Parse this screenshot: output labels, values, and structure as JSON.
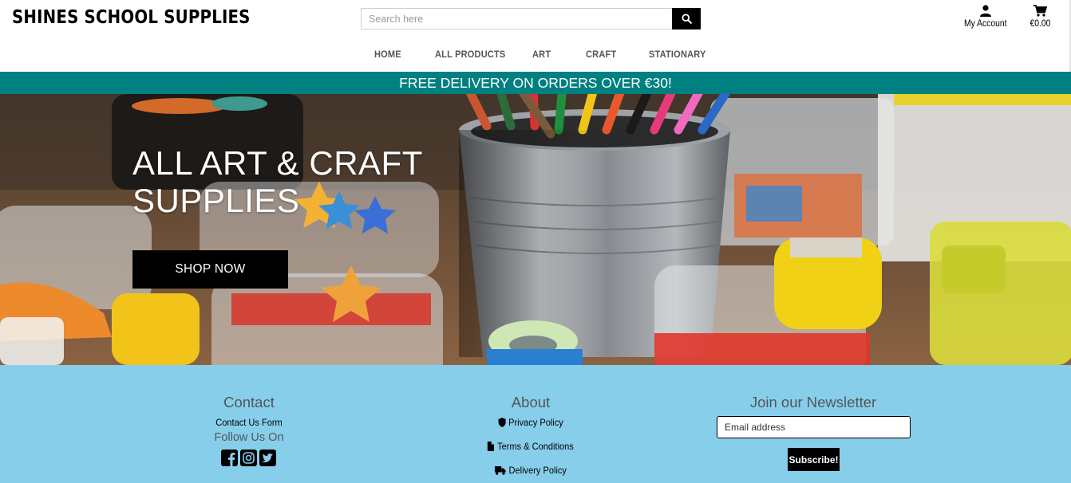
{
  "header": {
    "brand": "SHINES SCHOOL SUPPLIES",
    "search_placeholder": "Search here",
    "account_label": "My Account",
    "cart_total": "€0.00"
  },
  "nav": {
    "items": [
      {
        "label": "HOME"
      },
      {
        "label": "ALL PRODUCTS"
      },
      {
        "label": "ART"
      },
      {
        "label": "CRAFT"
      },
      {
        "label": "STATIONARY"
      }
    ]
  },
  "banner": {
    "text": "FREE DELIVERY ON ORDERS OVER €30!",
    "color": "#008080"
  },
  "hero": {
    "title": "ALL ART & CRAFT SUPPLIES",
    "button_label": "SHOP NOW"
  },
  "footer": {
    "background": "#87ceeb",
    "contact": {
      "title": "Contact",
      "form_link": "Contact Us Form",
      "follow_label": "Follow Us On",
      "social_icons": [
        "facebook-icon",
        "instagram-icon",
        "twitter-icon"
      ]
    },
    "about": {
      "title": "About",
      "links": [
        {
          "label": "Privacy Policy",
          "icon": "shield-icon"
        },
        {
          "label": "Terms & Conditions",
          "icon": "file-icon"
        },
        {
          "label": "Delivery Policy",
          "icon": "truck-icon"
        }
      ]
    },
    "newsletter": {
      "title": "Join our Newsletter",
      "email_placeholder": "Email address",
      "button_label": "Subscribe!"
    }
  }
}
